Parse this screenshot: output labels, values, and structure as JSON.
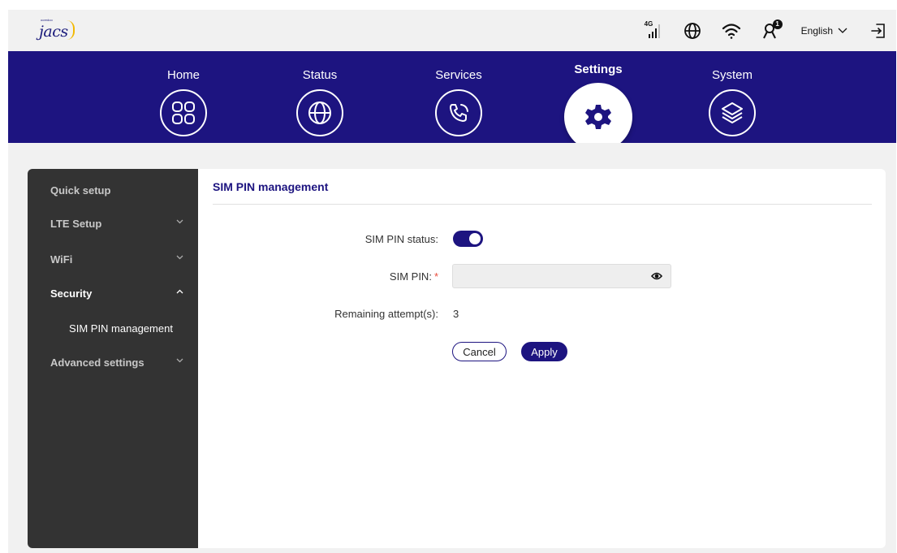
{
  "header": {
    "logo_text": "jacs",
    "logo_small_text": "ooredoo",
    "network_type": "4G",
    "language": "English"
  },
  "nav": {
    "items": [
      {
        "label": "Home",
        "icon": "home-grid-icon"
      },
      {
        "label": "Status",
        "icon": "globe-icon"
      },
      {
        "label": "Services",
        "icon": "phone-icon"
      },
      {
        "label": "Settings",
        "icon": "gear-icon",
        "active": true
      },
      {
        "label": "System",
        "icon": "layers-icon"
      }
    ]
  },
  "sidebar": {
    "items": [
      {
        "label": "Quick setup"
      },
      {
        "label": "LTE Setup"
      },
      {
        "label": "WiFi"
      },
      {
        "label": "Security",
        "expanded": true,
        "children": [
          {
            "label": "SIM PIN management"
          }
        ]
      },
      {
        "label": "Advanced settings"
      }
    ]
  },
  "main": {
    "title": "SIM PIN management",
    "status_label": "SIM PIN status:",
    "status_enabled": true,
    "pin_label": "SIM PIN:",
    "pin_required_mark": "*",
    "pin_value": "",
    "remaining_label": "Remaining attempt(s):",
    "remaining_value": "3",
    "cancel_label": "Cancel",
    "apply_label": "Apply"
  },
  "colors": {
    "brand": "#1d1480",
    "sidebar_bg": "#333333",
    "required": "#e84c3d"
  }
}
